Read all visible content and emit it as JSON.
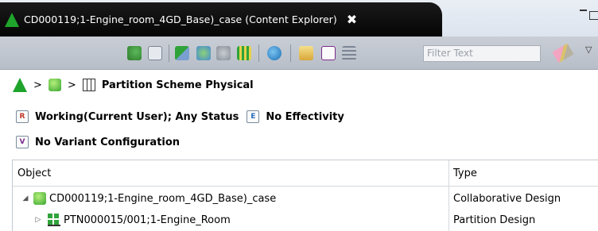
{
  "tab": {
    "title": "CD000119;1-Engine_room_4GD_Base)_case (Content Explorer)",
    "close_glyph": "✖"
  },
  "toolbar": {
    "filter_placeholder": "Filter Text",
    "icons": [
      "structure-icon",
      "properties-icon",
      "partition-add-icon",
      "gears-icon",
      "settings-icon",
      "grid-icon",
      "globe-icon",
      "open-icon",
      "effectivity-icon",
      "tree-icon",
      "eraser-icon",
      "menu-arrow-icon"
    ]
  },
  "breadcrumb": {
    "separator": ">",
    "current": "Partition Scheme Physical"
  },
  "info": {
    "revision_rule": "Working(Current User); Any Status",
    "effectivity": "No Effectivity",
    "variant": "No Variant Configuration",
    "rule_glyph_r": "R",
    "rule_glyph_e": "E",
    "rule_glyph_v": "V"
  },
  "table": {
    "columns": [
      "Object",
      "Type"
    ],
    "rows": [
      {
        "object": "CD000119;1-Engine_room_4GD_Base)_case",
        "type": "Collaborative Design",
        "expanded": true
      },
      {
        "object": "PTN000015/001;1-Engine_Room",
        "type": "Partition Design",
        "expanded": false
      }
    ],
    "twisty_expanded": "◢",
    "twisty_collapsed": "▷"
  },
  "colors": {
    "tab_bg": "#0b0b0b",
    "toolbar_bg": "#c0c6cf",
    "brand_green": "#1fa42b"
  }
}
